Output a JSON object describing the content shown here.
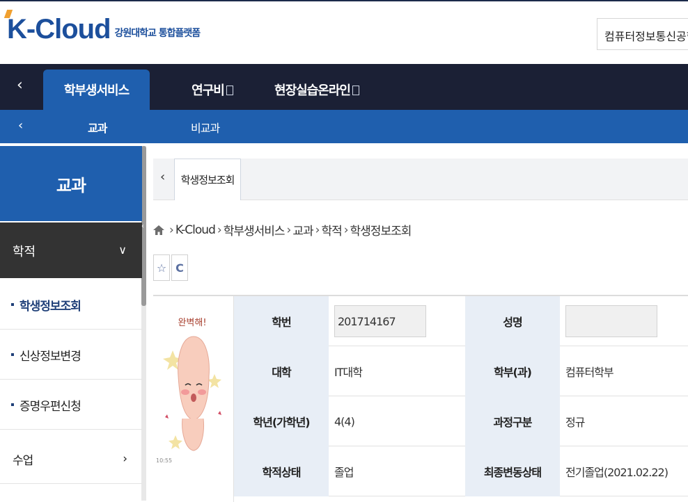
{
  "header": {
    "logo": "K-Cloud",
    "logo_subtitle": "강원대학교 통합플랫폼",
    "department_select": "컴퓨터정보통신공학전공"
  },
  "top_nav": {
    "tabs": [
      {
        "label": "학부생서비스"
      },
      {
        "label": "연구비"
      },
      {
        "label": "현장실습온라인"
      }
    ]
  },
  "sub_nav": {
    "items": [
      {
        "label": "교과"
      },
      {
        "label": "비교과"
      }
    ]
  },
  "sidebar": {
    "title": "교과",
    "group": {
      "label": "학적",
      "chevron": "∨"
    },
    "items": [
      {
        "label": "학생정보조회"
      },
      {
        "label": "신상정보변경"
      },
      {
        "label": "증명우편신청"
      },
      {
        "label": "수업"
      }
    ]
  },
  "main": {
    "tab": {
      "label": "학생정보조회"
    },
    "breadcrumb": [
      "K-Cloud",
      "학부생서비스",
      "교과",
      "학적",
      "학생정보조회"
    ],
    "tools": {
      "star": "☆",
      "refresh": "C"
    },
    "photo": {
      "caption": "완벽해!",
      "timestamp": "10:55"
    },
    "info": {
      "student_id_label": "학번",
      "student_id": "201714167",
      "name_label": "성명",
      "name": "",
      "college_label": "대학",
      "college": "IT대학",
      "dept_label": "학부(과)",
      "dept": "컴퓨터학부",
      "year_label": "학년(가학년)",
      "year": "4(4)",
      "course_label": "과정구분",
      "course": "정규",
      "status_label": "학적상태",
      "status": "졸업",
      "last_change_label": "최종변동상태",
      "last_change": "전기졸업(2021.02.22)"
    }
  }
}
